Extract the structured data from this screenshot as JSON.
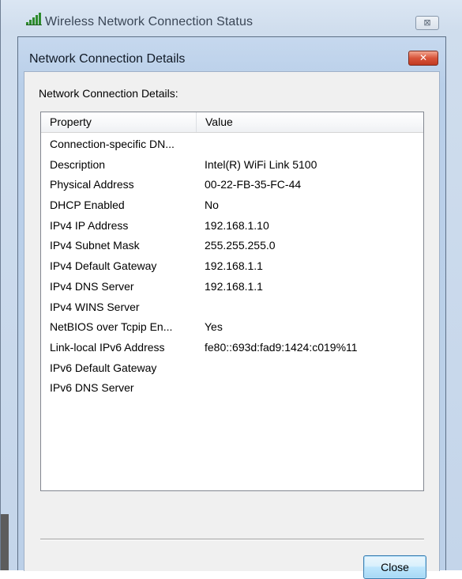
{
  "outer_window": {
    "title": "Wireless Network Connection Status",
    "icon": "wireless-signal-icon",
    "close_glyph": "⊠"
  },
  "dialog": {
    "title": "Network Connection Details",
    "close_glyph": "✕",
    "group_label": "Network Connection Details:",
    "columns": {
      "property": "Property",
      "value": "Value"
    },
    "rows": [
      {
        "property": "Connection-specific DN...",
        "value": ""
      },
      {
        "property": "Description",
        "value": "Intel(R) WiFi Link 5100"
      },
      {
        "property": "Physical Address",
        "value": "00-22-FB-35-FC-44"
      },
      {
        "property": "DHCP Enabled",
        "value": "No"
      },
      {
        "property": "IPv4 IP Address",
        "value": "192.168.1.10"
      },
      {
        "property": "IPv4 Subnet Mask",
        "value": "255.255.255.0"
      },
      {
        "property": "IPv4 Default Gateway",
        "value": "192.168.1.1"
      },
      {
        "property": "IPv4 DNS Server",
        "value": "192.168.1.1"
      },
      {
        "property": "IPv4 WINS Server",
        "value": ""
      },
      {
        "property": "NetBIOS over Tcpip En...",
        "value": "Yes"
      },
      {
        "property": "Link-local IPv6 Address",
        "value": "fe80::693d:fad9:1424:c019%11"
      },
      {
        "property": "IPv6 Default Gateway",
        "value": ""
      },
      {
        "property": "IPv6 DNS Server",
        "value": ""
      }
    ],
    "close_button": "Close"
  },
  "colors": {
    "titlebar_glass": "#c6d8ee",
    "close_red": "#c13a22",
    "button_blue": "#bee6fd",
    "signal_green": "#2e8b2e"
  }
}
